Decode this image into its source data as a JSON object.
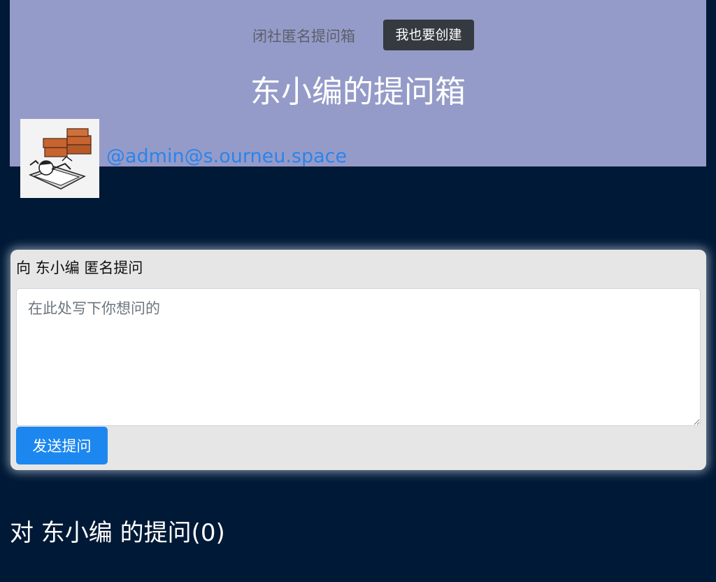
{
  "header": {
    "brand": "闭社匿名提问箱",
    "create_button": "我也要创建",
    "box_title": "东小编的提问箱",
    "handle": "@admin@s.ourneu.space"
  },
  "ask": {
    "label": "向 东小编 匿名提问",
    "placeholder": "在此处写下你想问的",
    "value": "",
    "submit_button": "发送提问"
  },
  "questions": {
    "heading": "对 东小编 的提问(0)"
  },
  "colors": {
    "page_bg": "#001936",
    "header_bg": "#959bc8",
    "primary": "#1d87f0",
    "dark_button": "#343a40",
    "link": "#2a84ec"
  }
}
